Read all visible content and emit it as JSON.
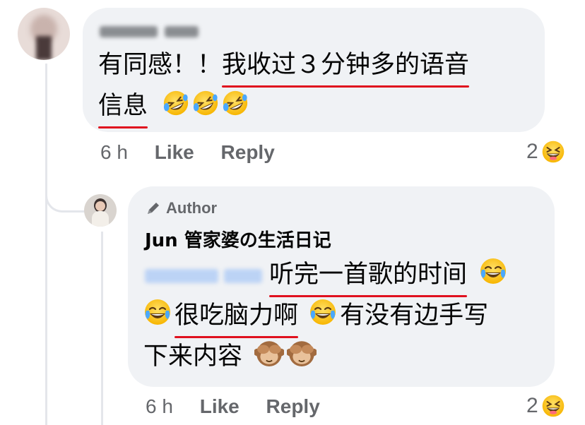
{
  "comments": [
    {
      "author_name": "",
      "text": {
        "line1_plain": "有同感！！",
        "line1_underlined": "我收过３分钟多的语音",
        "line2_underlined": "信息"
      },
      "emojis": [
        "rofl",
        "rofl",
        "rofl"
      ],
      "time": "6 h",
      "like_label": "Like",
      "reply_label": "Reply",
      "reaction_count": "2",
      "reaction_emoji": "laughing"
    },
    {
      "badge": "Author",
      "author_name": "Jun 管家婆の生活日记",
      "text": {
        "line1_underlined": "听完一首歌的时间",
        "line2_underlined": "很吃脑力啊",
        "line2_plain": "有没有边手写",
        "line3_plain": "下来内容"
      },
      "emojis": [
        "joy",
        "joy",
        "joy",
        "see-no-evil",
        "see-no-evil"
      ],
      "time": "6 h",
      "like_label": "Like",
      "reply_label": "Reply",
      "reaction_count": "2",
      "reaction_emoji": "laughing"
    }
  ],
  "colors": {
    "bubble": "#f0f2f5",
    "underline": "#e0101e",
    "meta_text": "#65676b",
    "thread_line": "#e4e6eb"
  }
}
